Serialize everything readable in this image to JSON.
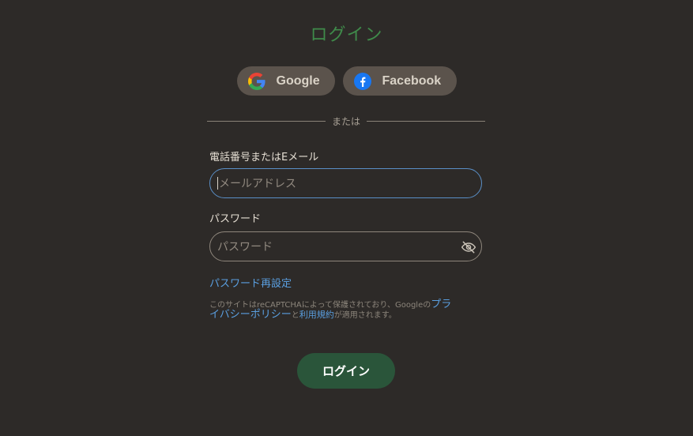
{
  "page": {
    "title": "ログイン"
  },
  "social": {
    "google_label": "Google",
    "facebook_label": "Facebook"
  },
  "divider": {
    "text": "または"
  },
  "form": {
    "phone_email_label": "電話番号またはEメール",
    "email_placeholder": "メールアドレス",
    "password_label": "パスワード",
    "password_placeholder": "パスワード",
    "reset_link": "パスワード再設定"
  },
  "notice": {
    "prefix": "このサイトはreCAPTCHAによって保護されており、Googleの",
    "privacy_link_a": "プラ",
    "privacy_link_b": "イバシーポリシー",
    "connector": "と",
    "terms_link": "利用規約",
    "suffix": "が適用されます。"
  },
  "submit": {
    "label": "ログイン"
  },
  "colors": {
    "background": "#2d2a28",
    "title": "#3f8a4a",
    "social_button": "#5b534c",
    "focus_border": "#5a8fc7",
    "link": "#5a9fe0",
    "submit_button": "#2a553a"
  },
  "icons": {
    "google": "google-g-icon",
    "facebook": "facebook-f-icon",
    "password_toggle": "eye-slash-icon"
  }
}
